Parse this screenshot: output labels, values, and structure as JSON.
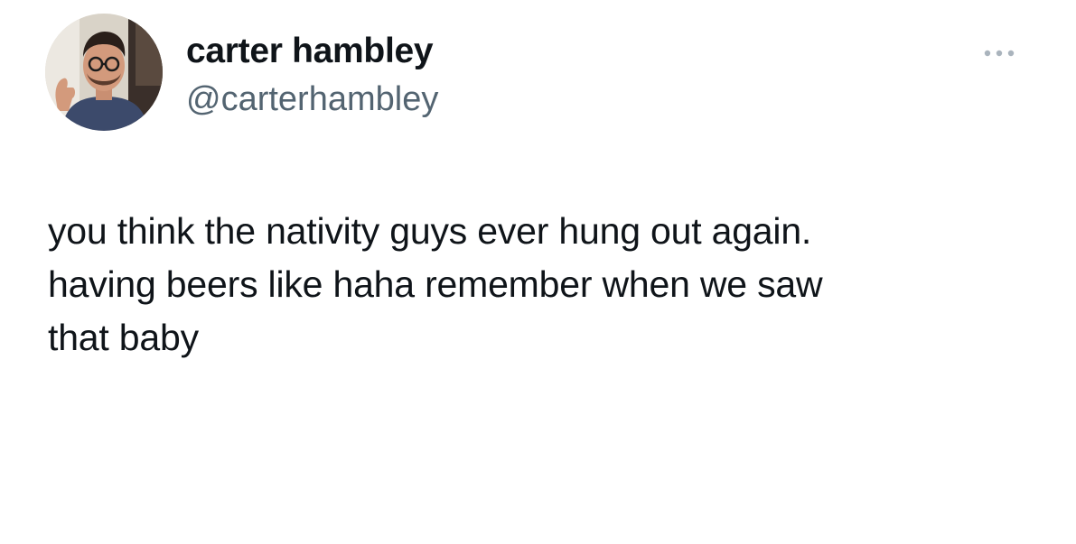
{
  "tweet": {
    "author": {
      "display_name": "carter hambley",
      "handle": "@carterhambley",
      "avatar_icon": "profile-photo"
    },
    "more_icon": "ellipsis-icon",
    "text_lines": [
      "you think the nativity guys ever hung out again.",
      "having beers like haha remember when we saw",
      "that baby"
    ]
  },
  "colors": {
    "background": "#ffffff",
    "text_primary": "#0f1419",
    "text_secondary": "#536471",
    "more_dots": "#aab4bd"
  }
}
